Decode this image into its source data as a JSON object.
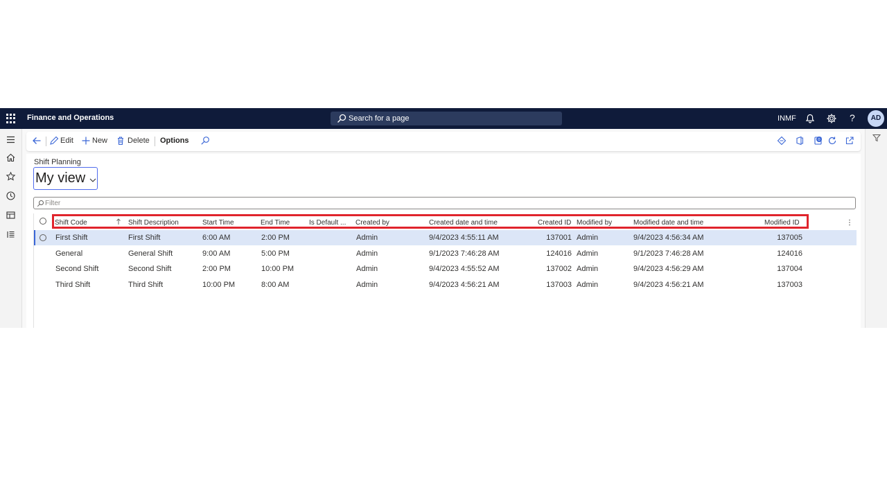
{
  "topbar": {
    "app_title": "Finance and Operations",
    "search_placeholder": "Search for a page",
    "company": "INMF",
    "avatar_initials": "AD",
    "help_label": "?",
    "icons": [
      "waffle-icon",
      "bell-icon",
      "gear-icon",
      "help-icon"
    ]
  },
  "leftrail": {
    "icons": [
      "hamburger-icon",
      "home-icon",
      "star-icon",
      "clock-icon",
      "workspace-icon",
      "list-icon"
    ]
  },
  "actionpane": {
    "edit_label": "Edit",
    "new_label": "New",
    "delete_label": "Delete",
    "options_label": "Options"
  },
  "page": {
    "caption": "Shift Planning",
    "view_name": "My view",
    "filter_placeholder": "Filter"
  },
  "grid": {
    "columns": [
      "Shift Code",
      "Shift Description",
      "Start Time",
      "End Time",
      "Is Default ...",
      "Created by",
      "Created date and time",
      "Created ID",
      "Modified by",
      "Modified date and time",
      "Modified ID"
    ],
    "rows": [
      [
        "First Shift",
        "First Shift",
        "6:00 AM",
        "2:00 PM",
        "",
        "Admin",
        "9/4/2023 4:55:11 AM",
        "137001",
        "Admin",
        "9/4/2023 4:56:34 AM",
        "137005"
      ],
      [
        "General",
        "General Shift",
        "9:00 AM",
        "5:00 PM",
        "",
        "Admin",
        "9/1/2023 7:46:28 AM",
        "124016",
        "Admin",
        "9/1/2023 7:46:28 AM",
        "124016"
      ],
      [
        "Second Shift",
        "Second Shift",
        "2:00 PM",
        "10:00 PM",
        "",
        "Admin",
        "9/4/2023 4:55:52 AM",
        "137002",
        "Admin",
        "9/4/2023 4:56:29 AM",
        "137004"
      ],
      [
        "Third Shift",
        "Third Shift",
        "10:00 PM",
        "8:00 AM",
        "",
        "Admin",
        "9/4/2023 4:56:21 AM",
        "137003",
        "Admin",
        "9/4/2023 4:56:21 AM",
        "137003"
      ]
    ],
    "selected_row": 0
  },
  "colors": {
    "topbar_bg": "#0f1b3a",
    "selected_row_bg": "#dce6f7",
    "highlight_border": "#e0242c",
    "accent": "#3a66d6"
  }
}
